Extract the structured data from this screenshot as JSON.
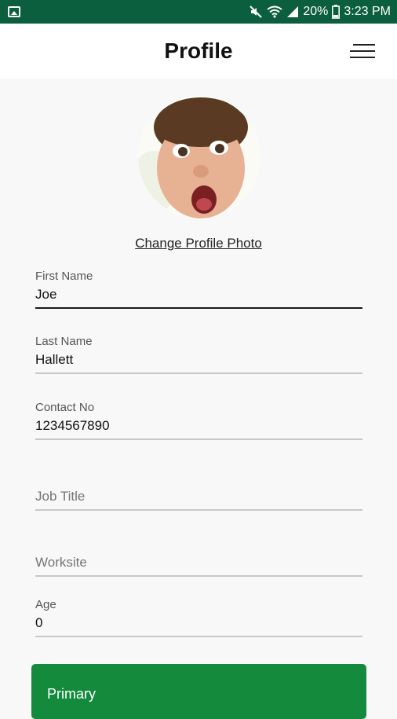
{
  "status_bar": {
    "battery": "20%",
    "time": "3:23 PM",
    "icons": [
      "image-notification-icon",
      "mute-icon",
      "wifi-icon",
      "signal-icon",
      "battery-icon"
    ]
  },
  "header": {
    "title": "Profile",
    "menu_icon": "hamburger-menu-icon"
  },
  "profile": {
    "change_photo_label": "Change Profile Photo"
  },
  "fields": {
    "first_name": {
      "label": "First Name",
      "value": "Joe"
    },
    "last_name": {
      "label": "Last Name",
      "value": "Hallett"
    },
    "contact": {
      "label": "Contact No",
      "value": "1234567890"
    },
    "job_title": {
      "placeholder": "Job Title"
    },
    "worksite": {
      "placeholder": "Worksite"
    },
    "age": {
      "label": "Age",
      "value": "0"
    }
  },
  "primary": {
    "label": "Primary"
  },
  "colors": {
    "status_bar": "#0b5e3e",
    "primary_button": "#148a3c",
    "background": "#f8f8f8"
  }
}
